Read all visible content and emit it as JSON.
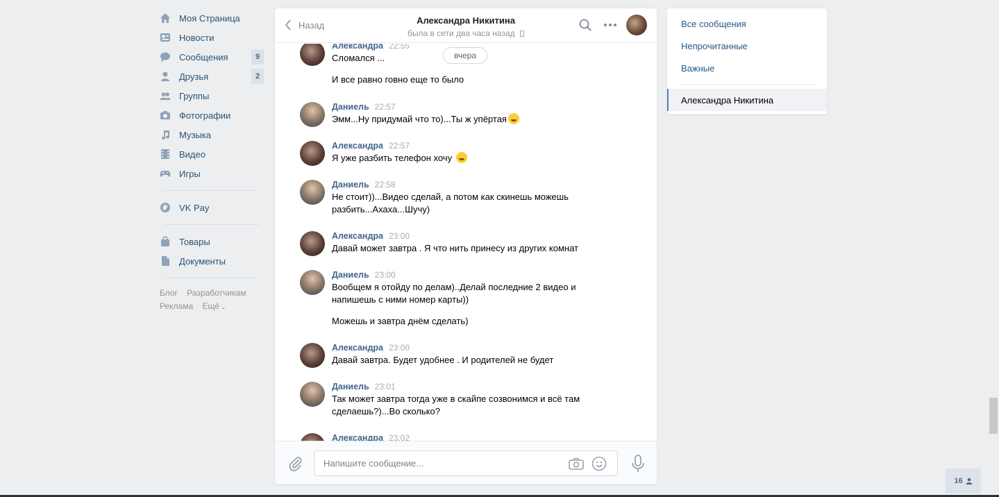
{
  "nav": {
    "items": [
      {
        "label": "Моя Страница",
        "icon": "home-icon",
        "count": ""
      },
      {
        "label": "Новости",
        "icon": "news-icon",
        "count": ""
      },
      {
        "label": "Сообщения",
        "icon": "messages-icon",
        "count": "9"
      },
      {
        "label": "Друзья",
        "icon": "friends-icon",
        "count": "2"
      },
      {
        "label": "Группы",
        "icon": "groups-icon",
        "count": ""
      },
      {
        "label": "Фотографии",
        "icon": "camera-icon",
        "count": ""
      },
      {
        "label": "Музыка",
        "icon": "music-icon",
        "count": ""
      },
      {
        "label": "Видео",
        "icon": "video-icon",
        "count": ""
      },
      {
        "label": "Игры",
        "icon": "gamepad-icon",
        "count": ""
      }
    ],
    "pay": {
      "label": "VK Pay",
      "icon": "ruble-icon"
    },
    "extra": [
      {
        "label": "Товары",
        "icon": "bag-icon"
      },
      {
        "label": "Документы",
        "icon": "document-icon"
      }
    ],
    "footer": {
      "blog": "Блог",
      "developers": "Разработчикам",
      "ads": "Реклама",
      "more": "Ещё"
    }
  },
  "chat": {
    "back_label": "Назад",
    "peer_name": "Александра Никитина",
    "peer_status": "была в сети два часа назад",
    "date_pill": "вчера",
    "messages": [
      {
        "author": "Александра",
        "time": "22:55",
        "text": "Сломался ...",
        "text2": "И все равно говно еще то было"
      },
      {
        "author": "Даниель",
        "time": "22:57",
        "text": "Эмм...Ну придумай что то)...Ты ж упёртая"
      },
      {
        "author": "Александра",
        "time": "22:57",
        "text": "Я уже разбить телефон хочу"
      },
      {
        "author": "Даниель",
        "time": "22:58",
        "text": "Не стоит))...Видео сделай, а потом как скинешь можешь разбить...Ахаха...Шучу)"
      },
      {
        "author": "Александра",
        "time": "23:00",
        "text": "Давай может завтра . Я что нить принесу из других комнат"
      },
      {
        "author": "Даниель",
        "time": "23:00",
        "text": "Вообщем я отойду по делам)..Делай последние 2 видео и напишешь с ними номер карты))",
        "text2": "Можешь и завтра днём сделать)"
      },
      {
        "author": "Александра",
        "time": "23:00",
        "text": "Давай завтра. Будет удобнее . И родителей не будет"
      },
      {
        "author": "Даниель",
        "time": "23:01",
        "text": "Так может завтра тогда уже в скайпе созвонимся и всё там сделаешь?)...Во сколько?"
      },
      {
        "author": "Александра",
        "time": "23:02",
        "text": ""
      }
    ],
    "composer_placeholder": "Напишите сообщение..."
  },
  "right_menu": {
    "all": "Все сообщения",
    "unread": "Непрочитанные",
    "important": "Важные",
    "active_conversation": "Александра Никитина"
  },
  "online_count": "16",
  "colors": {
    "link": "#2a5885",
    "nav": "#285473",
    "author": "#42648b",
    "accent": "#5181b8"
  }
}
